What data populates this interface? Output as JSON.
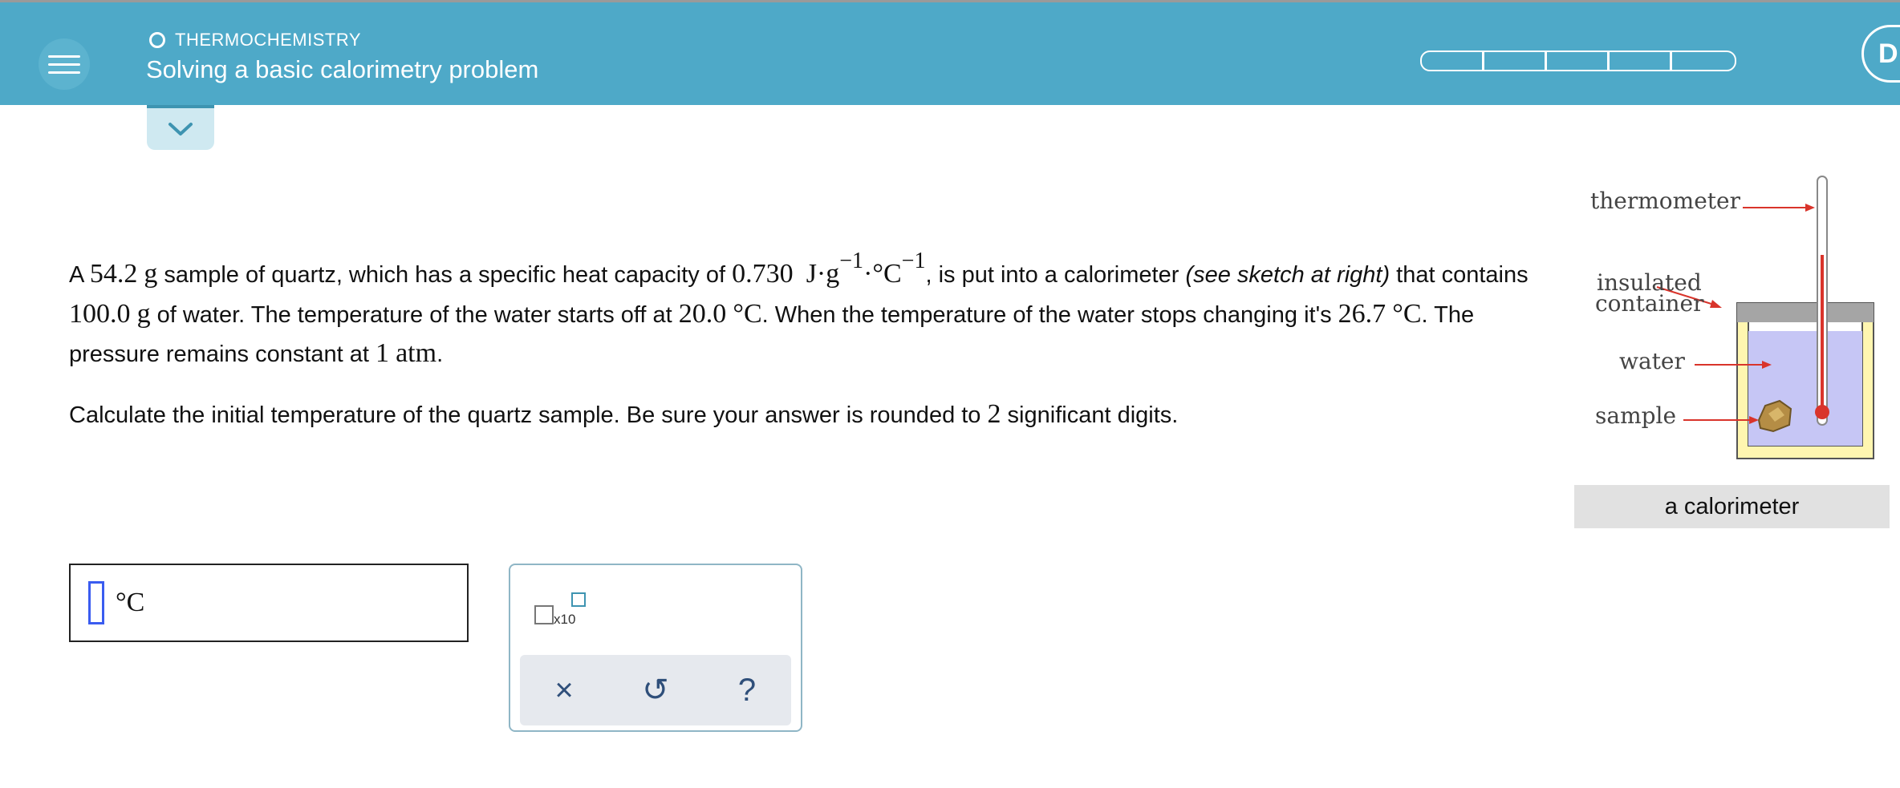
{
  "header": {
    "topic": "THERMOCHEMISTRY",
    "title": "Solving a basic calorimetry problem",
    "progress_segments": 5,
    "right_button_letter": "D"
  },
  "problem": {
    "p1": "A ",
    "mass": "54.2",
    "g1": "g",
    "p2": " sample of quartz, which has a specific heat capacity of ",
    "cp": "0.730",
    "cp_unit": "J·g",
    "exp1": "−1",
    "dot_c": "·°C",
    "exp2": "−1",
    "p3": ", is put into a calorimeter ",
    "italic": "(see sketch at right)",
    "p4": " that contains ",
    "water_mass": "100.0",
    "g2": "g",
    "p5": " of water. The temperature of the water starts off at ",
    "t_start": "20.0",
    "c1": "°C",
    "p6": ". When the temperature of the water stops changing it's ",
    "t_final": "26.7",
    "c2": "°C",
    "p7": ". The pressure remains constant at ",
    "pressure": "1",
    "atm": "atm",
    "p8": "."
  },
  "question": {
    "q1": "Calculate the initial temperature of the quartz sample. Be sure your answer is rounded to ",
    "digits": "2",
    "q2": " significant digits."
  },
  "answer": {
    "unit": "°C"
  },
  "keypad": {
    "x10_label": "x10",
    "clear_symbol": "×",
    "undo_symbol": "↺",
    "help_symbol": "?"
  },
  "sketch": {
    "thermometer": "thermometer",
    "insulated": "insulated",
    "container": "container",
    "water": "water",
    "sample": "sample",
    "caption": "a calorimeter"
  },
  "colors": {
    "header": "#4ea9c8",
    "water": "#c6c6f5",
    "container": "#fff6b0",
    "arrow": "#d9342b"
  }
}
